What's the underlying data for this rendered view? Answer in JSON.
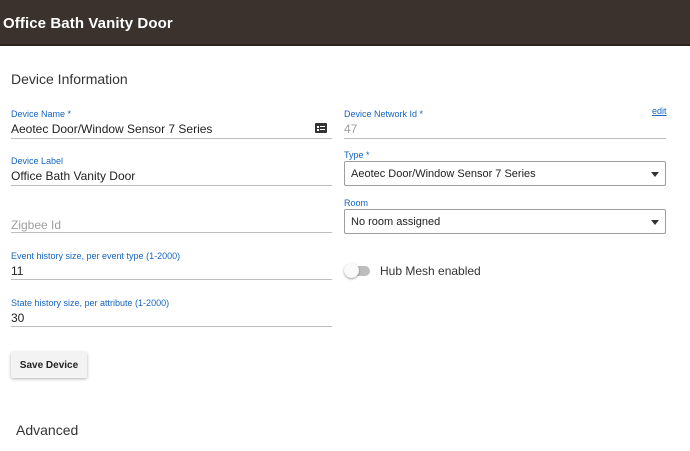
{
  "header": {
    "title": "Office Bath Vanity Door",
    "bg_color": "#3b322d"
  },
  "section": {
    "title": "Device Information"
  },
  "device_name": {
    "label": "Device Name *",
    "value": "Aeotec Door/Window Sensor 7 Series",
    "icon": "card-icon"
  },
  "network_id": {
    "label": "Device Network Id *",
    "value": "47",
    "edit_link": "edit"
  },
  "device_label": {
    "label": "Device Label",
    "value": "Office Bath Vanity Door"
  },
  "type": {
    "label": "Type *",
    "selected": "Aeotec Door/Window Sensor 7 Series"
  },
  "zigbee": {
    "placeholder": "Zigbee Id"
  },
  "room": {
    "label": "Room",
    "selected": "No room assigned"
  },
  "event_history": {
    "label": "Event history size, per event type (1-2000)",
    "value": "11"
  },
  "hub_mesh": {
    "label": "Hub Mesh enabled",
    "enabled": false
  },
  "state_history": {
    "label": "State history size, per attribute (1-2000)",
    "value": "30"
  },
  "save_button": {
    "label": "Save Device"
  },
  "advanced": {
    "title": "Advanced"
  },
  "colors": {
    "accent": "#1565c0"
  }
}
